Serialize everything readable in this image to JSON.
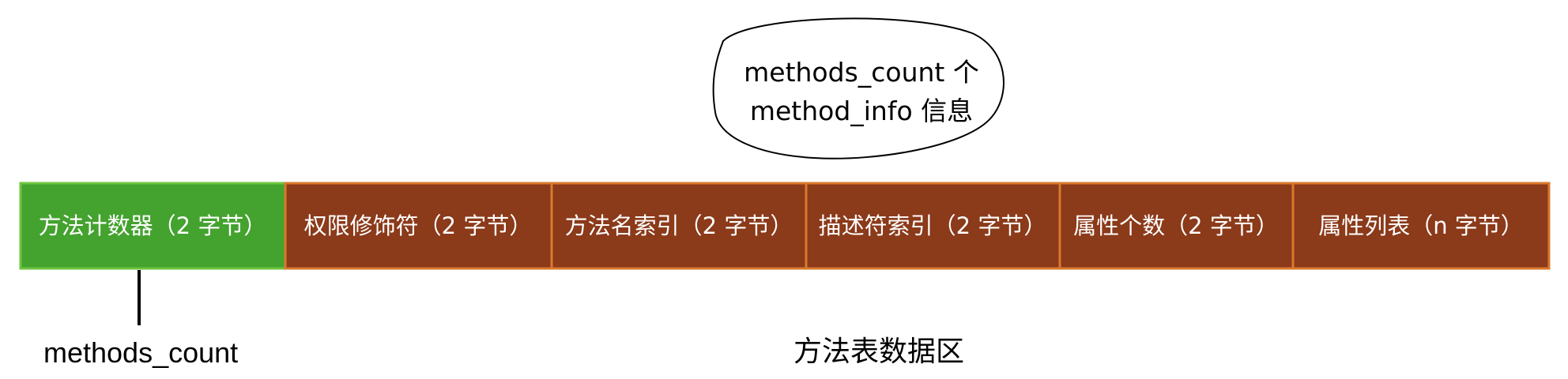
{
  "bubble": {
    "line1": "methods_count 个",
    "line2": "method_info 信息"
  },
  "cells": [
    {
      "label": "方法计数器（2 字节）",
      "fill": "#44A22F",
      "stroke": "#6CC53E"
    },
    {
      "label": "权限修饰符（2 字节）",
      "fill": "#8B3A1A",
      "stroke": "#D9792C"
    },
    {
      "label": "方法名索引（2 字节）",
      "fill": "#8B3A1A",
      "stroke": "#D9792C"
    },
    {
      "label": "描述符索引（2 字节）",
      "fill": "#8B3A1A",
      "stroke": "#D9792C"
    },
    {
      "label": "属性个数（2 字节）",
      "fill": "#8B3A1A",
      "stroke": "#D9792C"
    },
    {
      "label": "属性列表（n 字节）",
      "fill": "#8B3A1A",
      "stroke": "#D9792C"
    }
  ],
  "captions": {
    "methods_count": "methods_count",
    "method_table": "方法表数据区"
  }
}
